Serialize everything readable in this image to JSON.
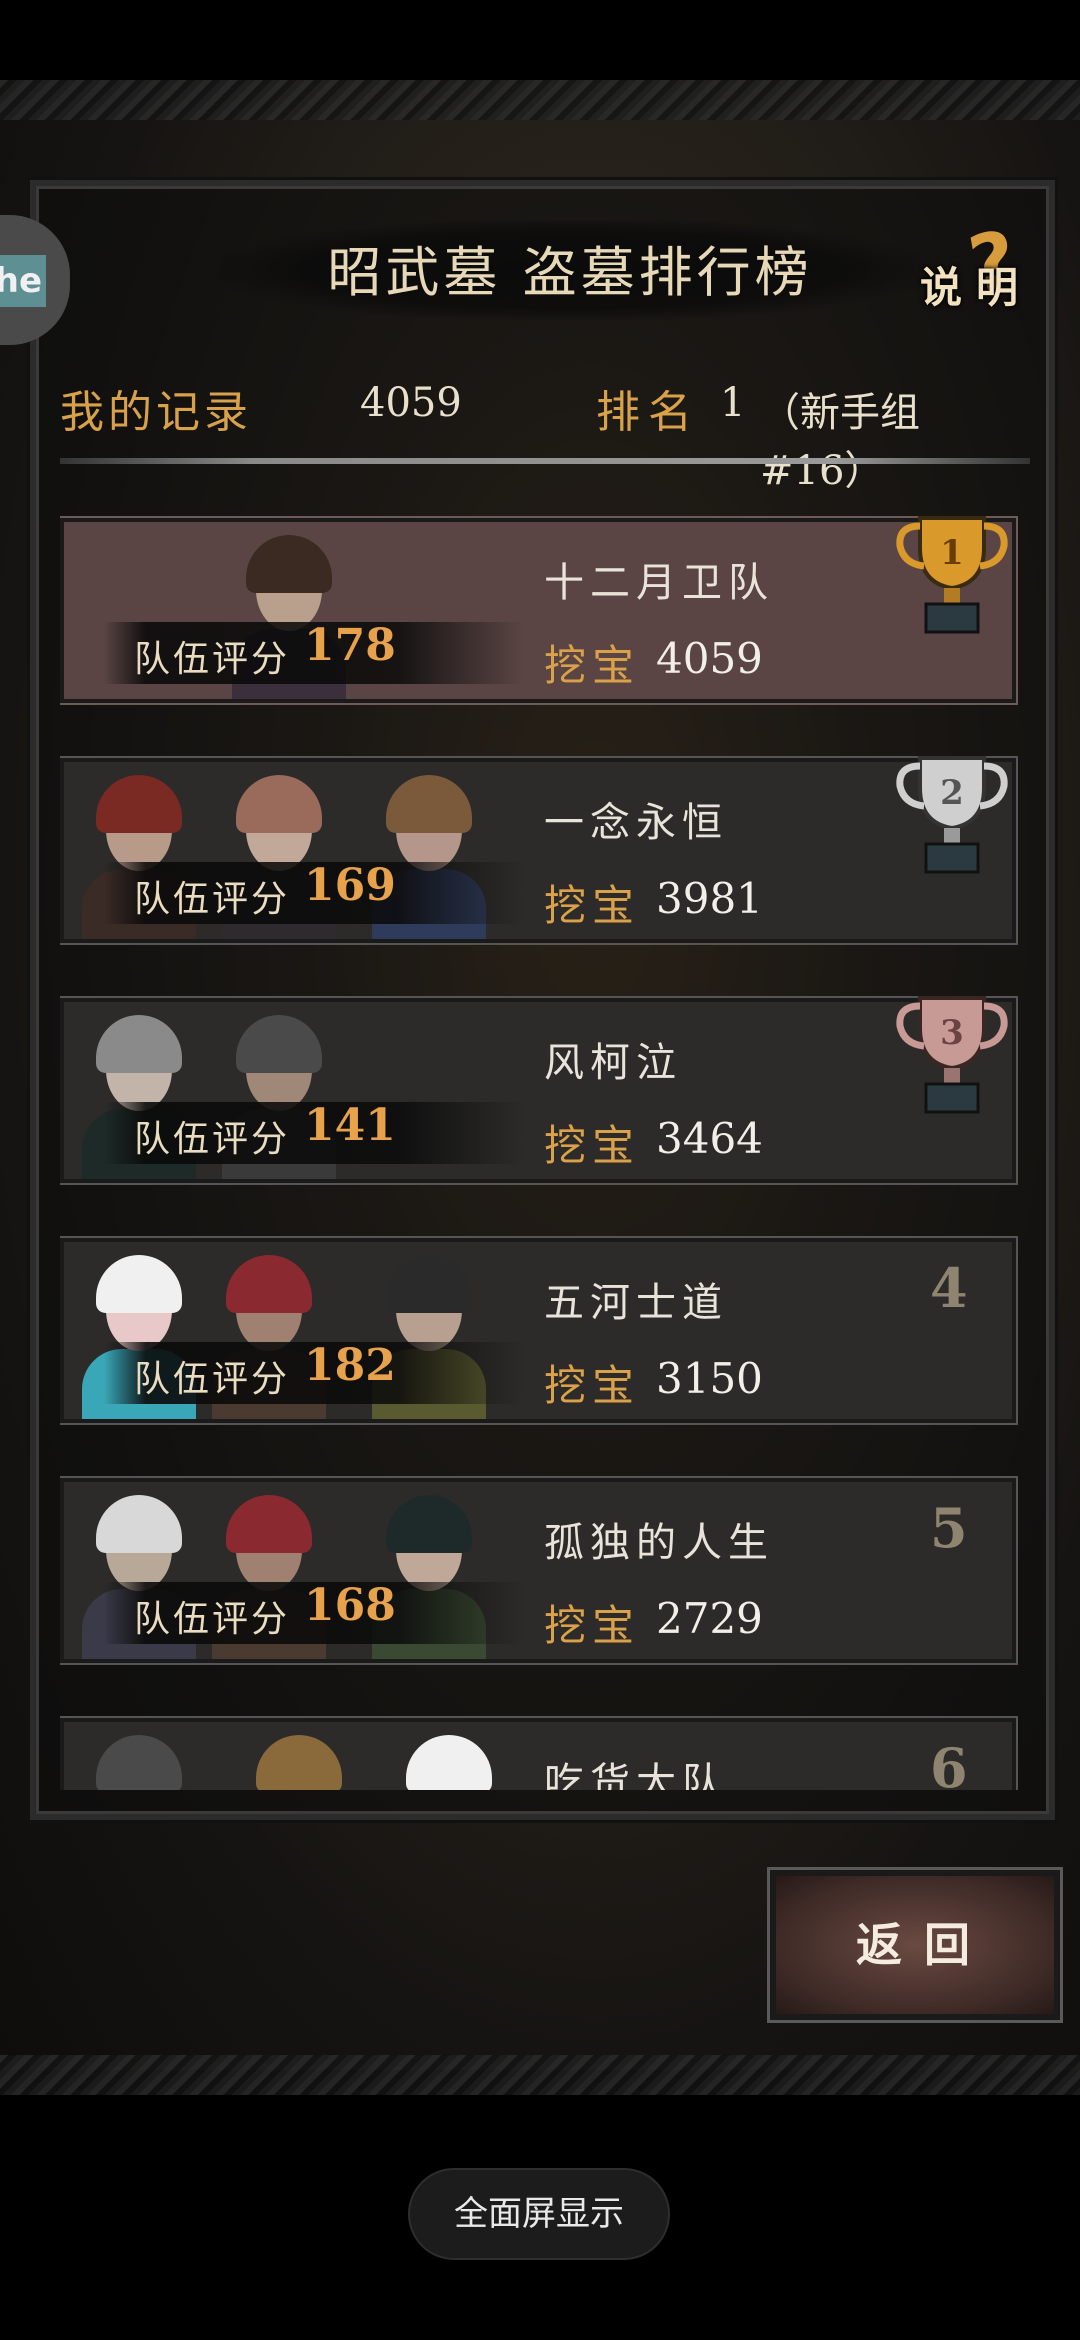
{
  "title": "昭武墓 盗墓排行榜",
  "help_label": "说明",
  "side_badge_text": "he",
  "my_record": {
    "label": "我的记录",
    "value": "4059"
  },
  "ranking": {
    "label": "排名",
    "value": "1",
    "group": "（新手组#16）"
  },
  "score_label": "队伍评分",
  "dig_label": "挖宝",
  "entries": [
    {
      "rank": "1",
      "name": "十二月卫队",
      "score": "178",
      "dig": "4059",
      "trophy": "gold"
    },
    {
      "rank": "2",
      "name": "一念永恒",
      "score": "169",
      "dig": "3981",
      "trophy": "silver"
    },
    {
      "rank": "3",
      "name": "风柯泣",
      "score": "141",
      "dig": "3464",
      "trophy": "bronze"
    },
    {
      "rank": "4",
      "name": "五河士道",
      "score": "182",
      "dig": "3150",
      "trophy": ""
    },
    {
      "rank": "5",
      "name": "孤独的人生",
      "score": "168",
      "dig": "2729",
      "trophy": ""
    },
    {
      "rank": "6",
      "name": "吃货大队",
      "score": "",
      "dig": "",
      "trophy": ""
    }
  ],
  "back_button": "返回",
  "fullscreen_button": "全面屏显示",
  "colors": {
    "gold": "#d99a2b",
    "silver": "#cfcfcf",
    "bronze": "#c89a96",
    "accent": "#d9a24a"
  }
}
